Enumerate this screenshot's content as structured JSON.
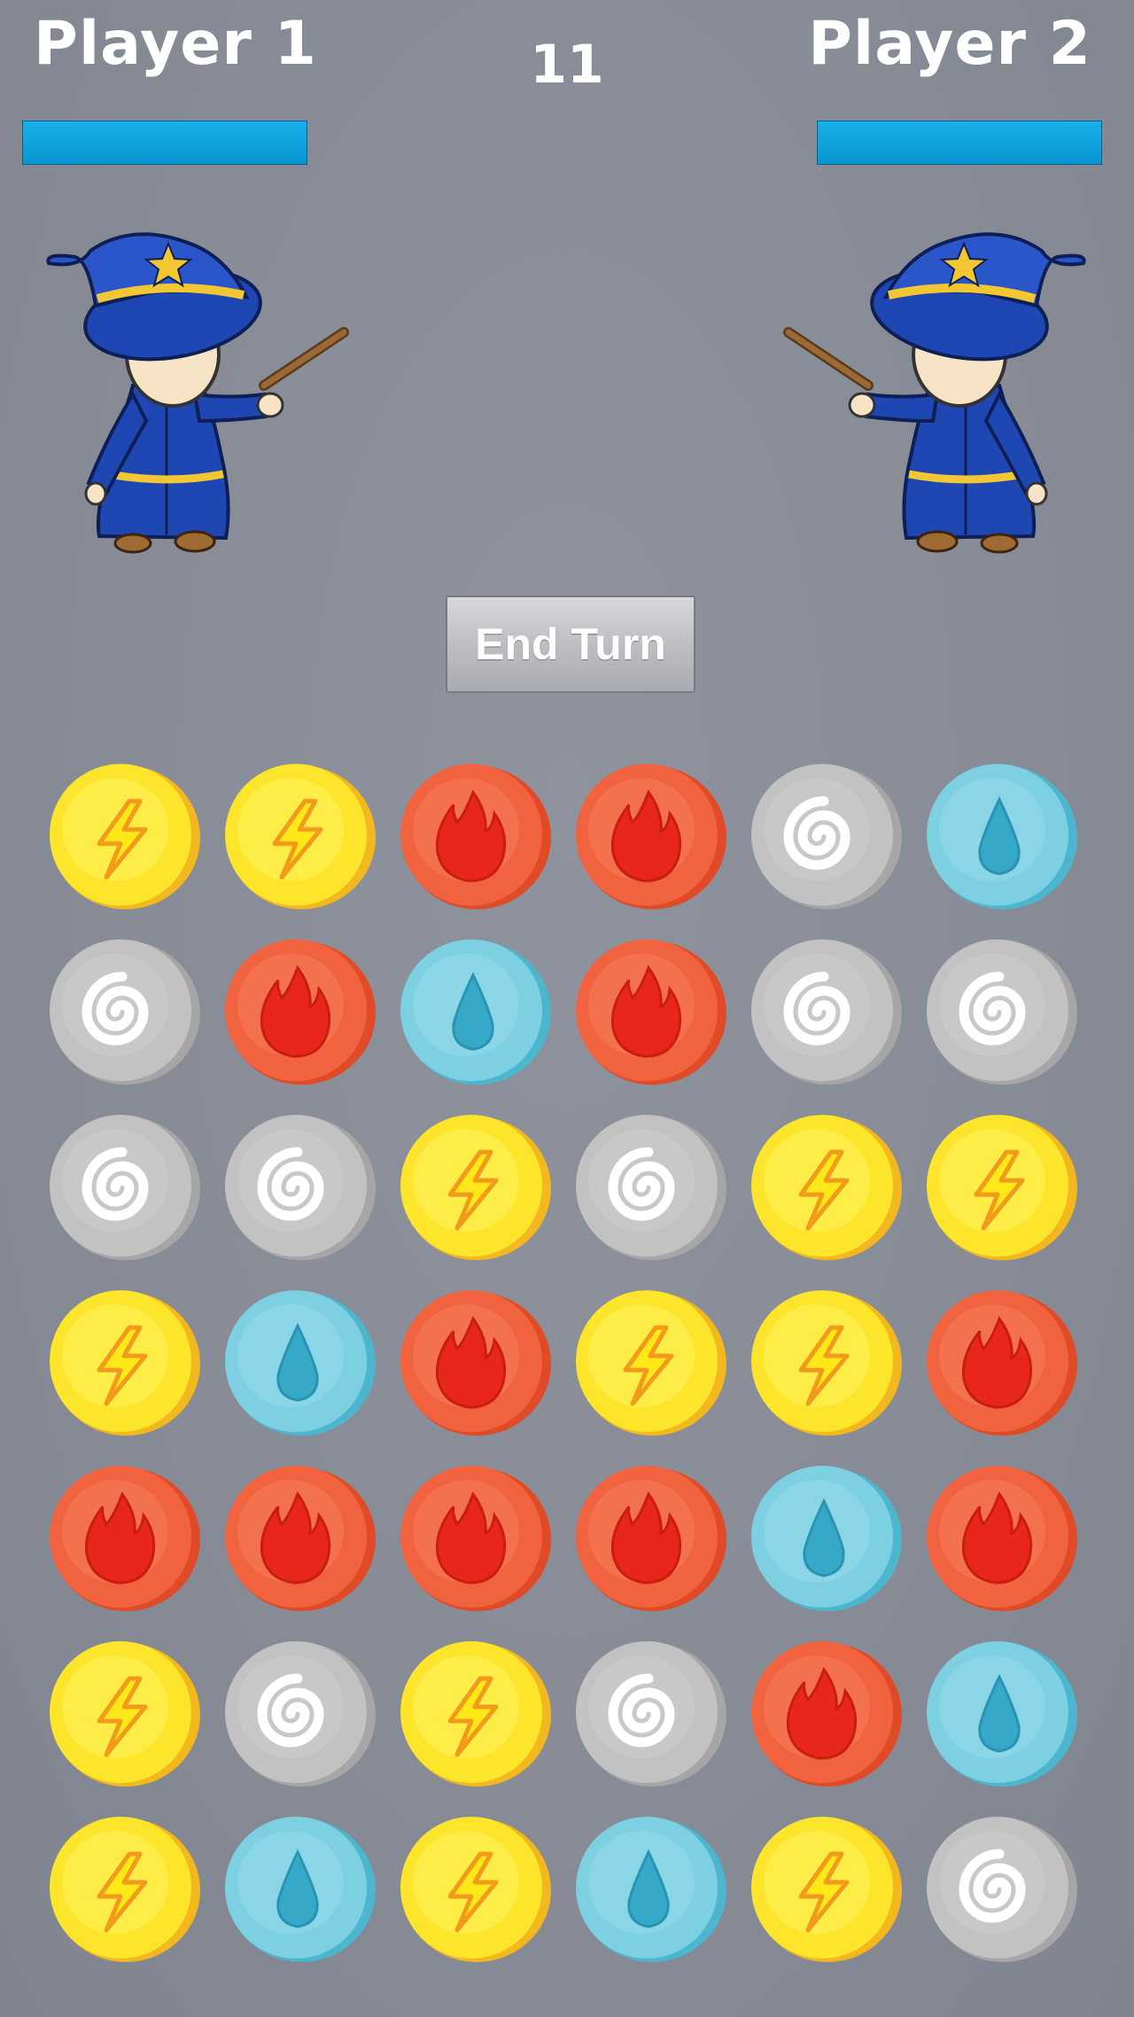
{
  "players": [
    {
      "name": "Player 1",
      "health": 1.0
    },
    {
      "name": "Player 2",
      "health": 1.0
    }
  ],
  "turn_counter": "11",
  "end_turn_label": "End Turn",
  "colors": {
    "health_bar": "#0aa0dc",
    "lightning": "#fde52b",
    "fire": "#f0633e",
    "water": "#7dd0e2",
    "wind": "#c2c2c2"
  },
  "board": {
    "rows": 7,
    "cols": 6,
    "gems": [
      [
        "lightning",
        "lightning",
        "fire",
        "fire",
        "wind",
        "water"
      ],
      [
        "wind",
        "fire",
        "water",
        "fire",
        "wind",
        "wind"
      ],
      [
        "wind",
        "wind",
        "lightning",
        "wind",
        "lightning",
        "lightning"
      ],
      [
        "lightning",
        "water",
        "fire",
        "lightning",
        "lightning",
        "fire"
      ],
      [
        "fire",
        "fire",
        "fire",
        "fire",
        "water",
        "fire"
      ],
      [
        "lightning",
        "wind",
        "lightning",
        "wind",
        "fire",
        "water"
      ],
      [
        "lightning",
        "water",
        "lightning",
        "water",
        "lightning",
        "wind"
      ]
    ]
  }
}
